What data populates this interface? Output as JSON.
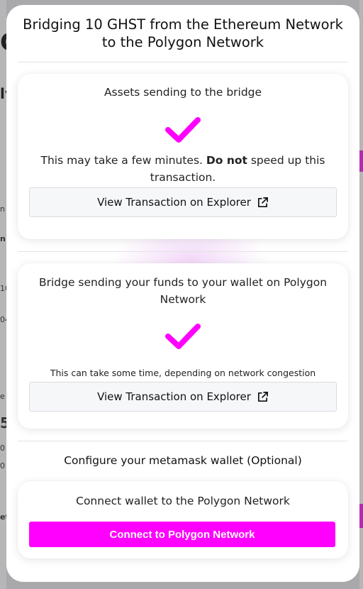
{
  "background": {
    "fragments": [
      "C",
      "ly",
      "n",
      "n",
      "10",
      "04",
      "e",
      "5",
      "0",
      "0",
      "et"
    ]
  },
  "modal": {
    "title": "Bridging 10 GHST from the Ethereum Network to the Polygon Network",
    "step1": {
      "text": "Assets sending to the bridge",
      "note_prefix": "This may take a few minutes.",
      "note_bold": "Do not",
      "note_suffix": "speed up this transaction.",
      "button_label": "View Transaction on Explorer",
      "icon": "check-icon"
    },
    "step2": {
      "text": "Bridge sending your funds to your wallet on Polygon Network",
      "note": "This can take some time, depending on network congestion",
      "button_label": "View Transaction on Explorer",
      "icon": "check-icon"
    },
    "configure": {
      "heading": "Configure your metamask wallet (Optional)",
      "text": "Connect wallet to the Polygon Network",
      "button_label": "Connect to Polygon Network"
    }
  },
  "colors": {
    "accent": "#ff00ff",
    "button_bg": "#f6f7f9"
  }
}
